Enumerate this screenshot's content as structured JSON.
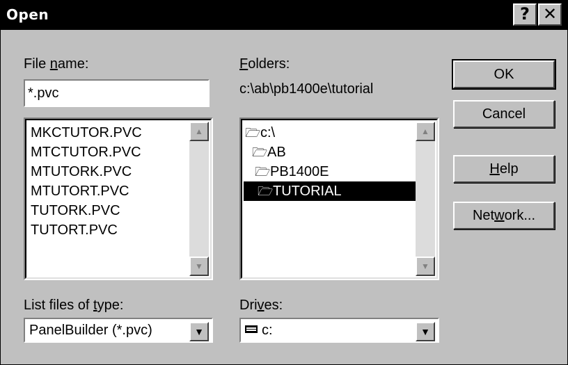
{
  "window": {
    "title": "Open",
    "help_glyph": "?",
    "close_glyph": "✕"
  },
  "file_name": {
    "label_pre": "File ",
    "label_u": "n",
    "label_post": "ame:",
    "value": "*.pvc",
    "files": [
      "MKCTUTOR.PVC",
      "MTCTUTOR.PVC",
      "MTUTORK.PVC",
      "MTUTORT.PVC",
      "TUTORK.PVC",
      "TUTORT.PVC"
    ]
  },
  "folders": {
    "label_u": "F",
    "label_post": "olders:",
    "current_path": "c:\\ab\\pb1400e\\tutorial",
    "tree": [
      {
        "name": "c:\\",
        "icon": "open-folder-icon",
        "selected": false
      },
      {
        "name": "AB",
        "icon": "open-folder-icon",
        "selected": false
      },
      {
        "name": "PB1400E",
        "icon": "open-folder-icon",
        "selected": false
      },
      {
        "name": "TUTORIAL",
        "icon": "open-folder-icon",
        "selected": true
      }
    ]
  },
  "file_type": {
    "label_pre": "List files of ",
    "label_u": "t",
    "label_post": "ype:",
    "selected": "PanelBuilder (*.pvc)"
  },
  "drives": {
    "label_pre": "Dri",
    "label_u": "v",
    "label_post": "es:",
    "selected": "c:",
    "icon": "drive-icon"
  },
  "buttons": {
    "ok": "OK",
    "cancel": "Cancel",
    "help_u": "H",
    "help_post": "elp",
    "network_pre": "Net",
    "network_u": "w",
    "network_post": "ork..."
  },
  "colors": {
    "dialog_bg": "#c0c0c0",
    "title_bg": "#000000",
    "selection_bg": "#000000"
  }
}
